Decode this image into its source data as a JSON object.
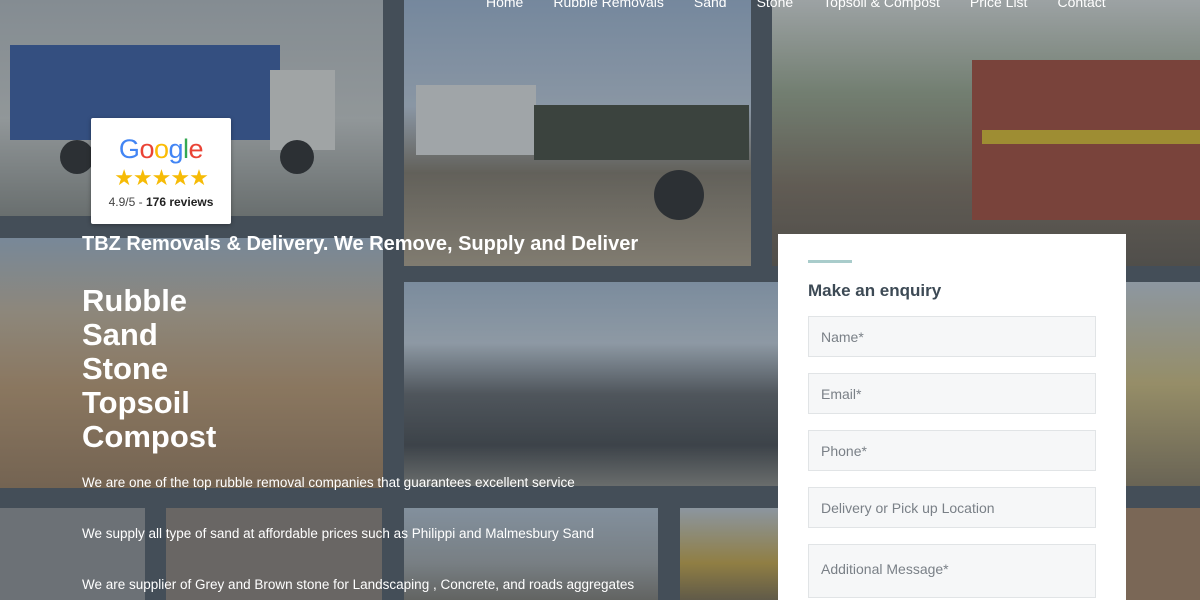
{
  "nav": {
    "items": [
      "Home",
      "Rubble Removals",
      "Sand",
      "Stone",
      "Topsoil & Compost",
      "Price List",
      "Contact"
    ]
  },
  "google_badge": {
    "logo_letters": [
      "G",
      "o",
      "o",
      "g",
      "l",
      "e"
    ],
    "stars": "★★★★★",
    "rating": "4.9/5",
    "separator": " - ",
    "reviews": "176 reviews"
  },
  "hero": {
    "tagline": "TBZ Removals & Delivery. We Remove, Supply and Deliver",
    "services": [
      "Rubble",
      "Sand",
      "Stone",
      "Topsoil",
      "Compost"
    ],
    "descriptions": [
      "We are one of the top rubble removal companies that guarantees excellent service",
      "We supply all type of sand at affordable prices such as Philippi and Malmesbury Sand",
      "We are supplier of Grey and Brown stone for Landscaping , Concrete, and roads aggregates"
    ]
  },
  "form": {
    "title": "Make an enquiry",
    "name_placeholder": "Name*",
    "email_placeholder": "Email*",
    "phone_placeholder": "Phone*",
    "location_placeholder": "Delivery or Pick up Location",
    "message_placeholder": "Additional Message*"
  },
  "colors": {
    "accent_line": "#a9cccb",
    "form_title": "#3d4a55",
    "star": "#F6BB06"
  }
}
